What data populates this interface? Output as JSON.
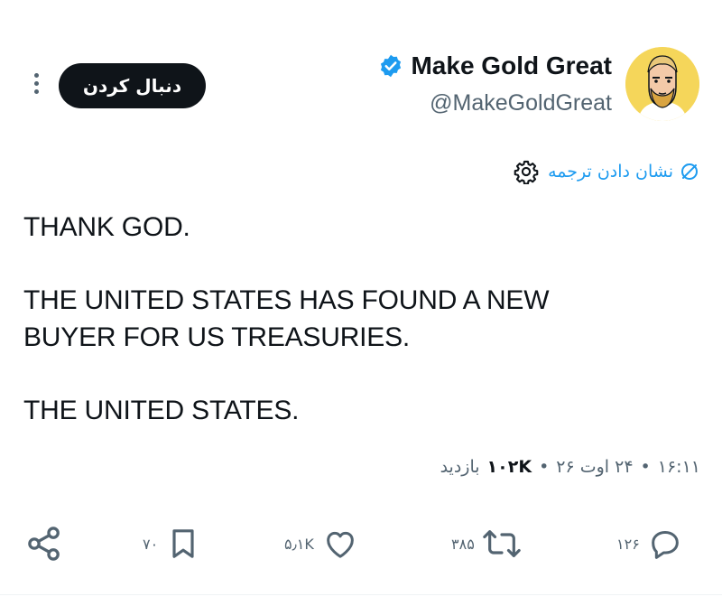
{
  "header": {
    "display_name": "Make Gold Great",
    "handle": "@MakeGoldGreat",
    "follow_label": "دنبال کردن",
    "verified": true
  },
  "translate": {
    "label": "نشان دادن ترجمه"
  },
  "tweet": {
    "lines": [
      "THANK GOD.",
      "THE UNITED STATES HAS FOUND A NEW",
      "BUYER FOR US TREASURIES.",
      "THE UNITED STATES."
    ]
  },
  "meta": {
    "time": "۱۶:۱۱",
    "date": "۲۴ اوت ۲۶",
    "views_count": "۱۰۲K",
    "views_label": "بازدید",
    "separator": "•"
  },
  "actions": {
    "replies": "۱۲۶",
    "retweets": "۳۸۵",
    "likes": "۵٫۱K",
    "bookmarks": "۷۰"
  },
  "colors": {
    "accent": "#1d9bf0",
    "text": "#0f1419",
    "muted": "#536471",
    "avatar_bg": "#f5d65a"
  },
  "icons": {
    "verified": "verified-badge-icon",
    "more": "more-vertical-icon",
    "translate": "translate-icon",
    "settings": "gear-icon",
    "reply": "reply-icon",
    "retweet": "retweet-icon",
    "like": "heart-icon",
    "bookmark": "bookmark-icon",
    "share": "share-icon"
  }
}
